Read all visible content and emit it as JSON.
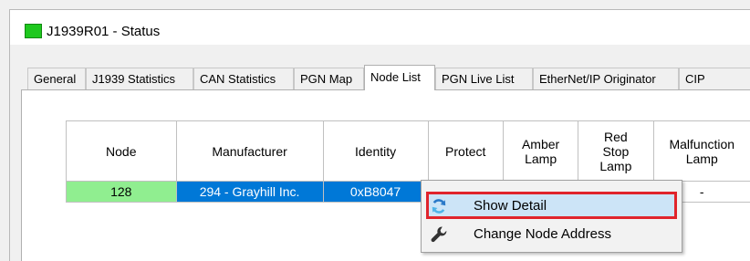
{
  "window": {
    "title": "J1939R01 - Status",
    "status_color": "#1ec81e"
  },
  "tabs": [
    {
      "label": "General"
    },
    {
      "label": "J1939 Statistics"
    },
    {
      "label": "CAN Statistics"
    },
    {
      "label": "PGN Map"
    },
    {
      "label": "Node List",
      "active": true
    },
    {
      "label": "PGN Live List"
    },
    {
      "label": "EtherNet/IP Originator"
    },
    {
      "label": "CIP"
    }
  ],
  "node_table": {
    "headers": [
      {
        "l1": "Node",
        "l2": "",
        "l3": ""
      },
      {
        "l1": "Manufacturer",
        "l2": "",
        "l3": ""
      },
      {
        "l1": "Identity",
        "l2": "",
        "l3": ""
      },
      {
        "l1": "Protect",
        "l2": "",
        "l3": ""
      },
      {
        "l1": "Amber",
        "l2": "Lamp",
        "l3": ""
      },
      {
        "l1": "Red",
        "l2": "Stop",
        "l3": "Lamp"
      },
      {
        "l1": "Malfunction",
        "l2": "Lamp",
        "l3": ""
      }
    ],
    "rows": [
      {
        "node": "128",
        "manufacturer": "294 - Grayhill Inc.",
        "identity": "0xB8047",
        "protect": "",
        "amber": "",
        "red": "",
        "malfunction": "-"
      }
    ]
  },
  "context_menu": {
    "items": [
      {
        "label": "Show Detail",
        "icon": "refresh-icon"
      },
      {
        "label": "Change Node Address",
        "icon": "wrench-icon"
      }
    ]
  },
  "colors": {
    "node_cell": "#90ee90",
    "selection": "#0078d7",
    "menu_highlight": "#cce4f7",
    "highlight_border": "#e0242c"
  }
}
